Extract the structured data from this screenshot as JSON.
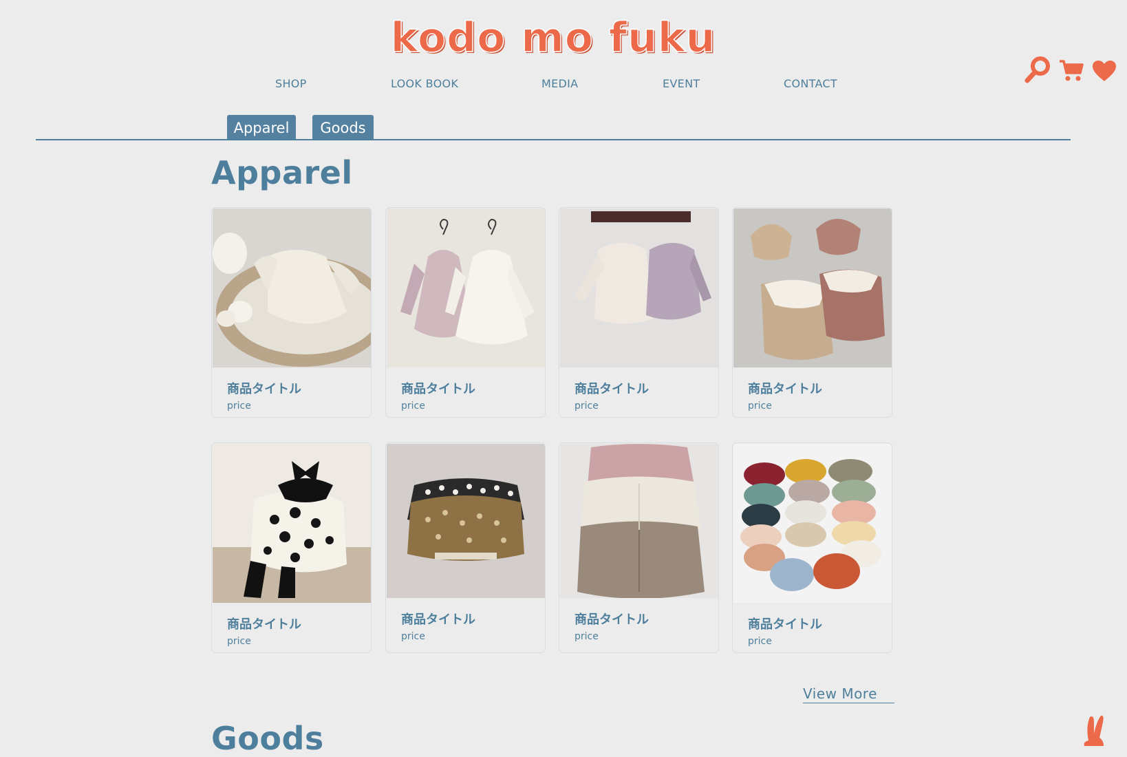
{
  "brand": {
    "logo_text": "kodo mo fuku"
  },
  "nav": {
    "items": [
      "SHOP",
      "LOOK BOOK",
      "MEDIA",
      "EVENT",
      "CONTACT"
    ]
  },
  "header_icons": [
    "search-icon",
    "cart-icon",
    "heart-icon"
  ],
  "tabs": [
    "Apparel",
    "Goods"
  ],
  "sections": {
    "apparel_title": "Apparel",
    "goods_title": "Goods"
  },
  "products": [
    {
      "title": "商品タイトル",
      "price": "price",
      "image": "cream-lace-romper-in-basket"
    },
    {
      "title": "商品タイトル",
      "price": "price",
      "image": "pink-and-white-tulle-dresses"
    },
    {
      "title": "商品タイトル",
      "price": "price",
      "image": "ivory-and-lavender-rompers-on-rack"
    },
    {
      "title": "商品タイトル",
      "price": "price",
      "image": "sailor-collar-rompers-with-bonnets"
    },
    {
      "title": "商品タイトル",
      "price": "price",
      "image": "polka-dot-romper-with-bow"
    },
    {
      "title": "商品タイトル",
      "price": "price",
      "image": "leopard-knit-cardigans"
    },
    {
      "title": "商品タイトル",
      "price": "price",
      "image": "cable-knit-cardigans-stack"
    },
    {
      "title": "商品タイトル",
      "price": "price",
      "image": "colorful-baby-bibs"
    }
  ],
  "view_more": "View More",
  "colors": {
    "accent": "#ec6a4a",
    "primary": "#4d7f9c",
    "background": "#ececec",
    "tab_bg": "#5581a0"
  }
}
